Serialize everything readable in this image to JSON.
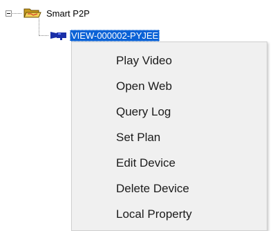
{
  "tree": {
    "root": {
      "label": "Smart P2P",
      "icon": "folder-open-icon",
      "expander": "minus"
    },
    "child": {
      "label": "VIEW-000002-PYJEE",
      "icon": "camera-icon",
      "selected": true
    }
  },
  "context_menu": {
    "items": [
      {
        "label": "Play Video"
      },
      {
        "label": "Open Web"
      },
      {
        "label": "Query Log"
      },
      {
        "label": "Set Plan"
      },
      {
        "label": "Edit Device"
      },
      {
        "label": "Delete Device"
      },
      {
        "label": "Local Property"
      }
    ]
  },
  "colors": {
    "selection_bg": "#0a62d6",
    "menu_bg": "#f0f0f0",
    "folder_yellow": "#e8c44a",
    "camera_blue": "#1a2fa8"
  }
}
